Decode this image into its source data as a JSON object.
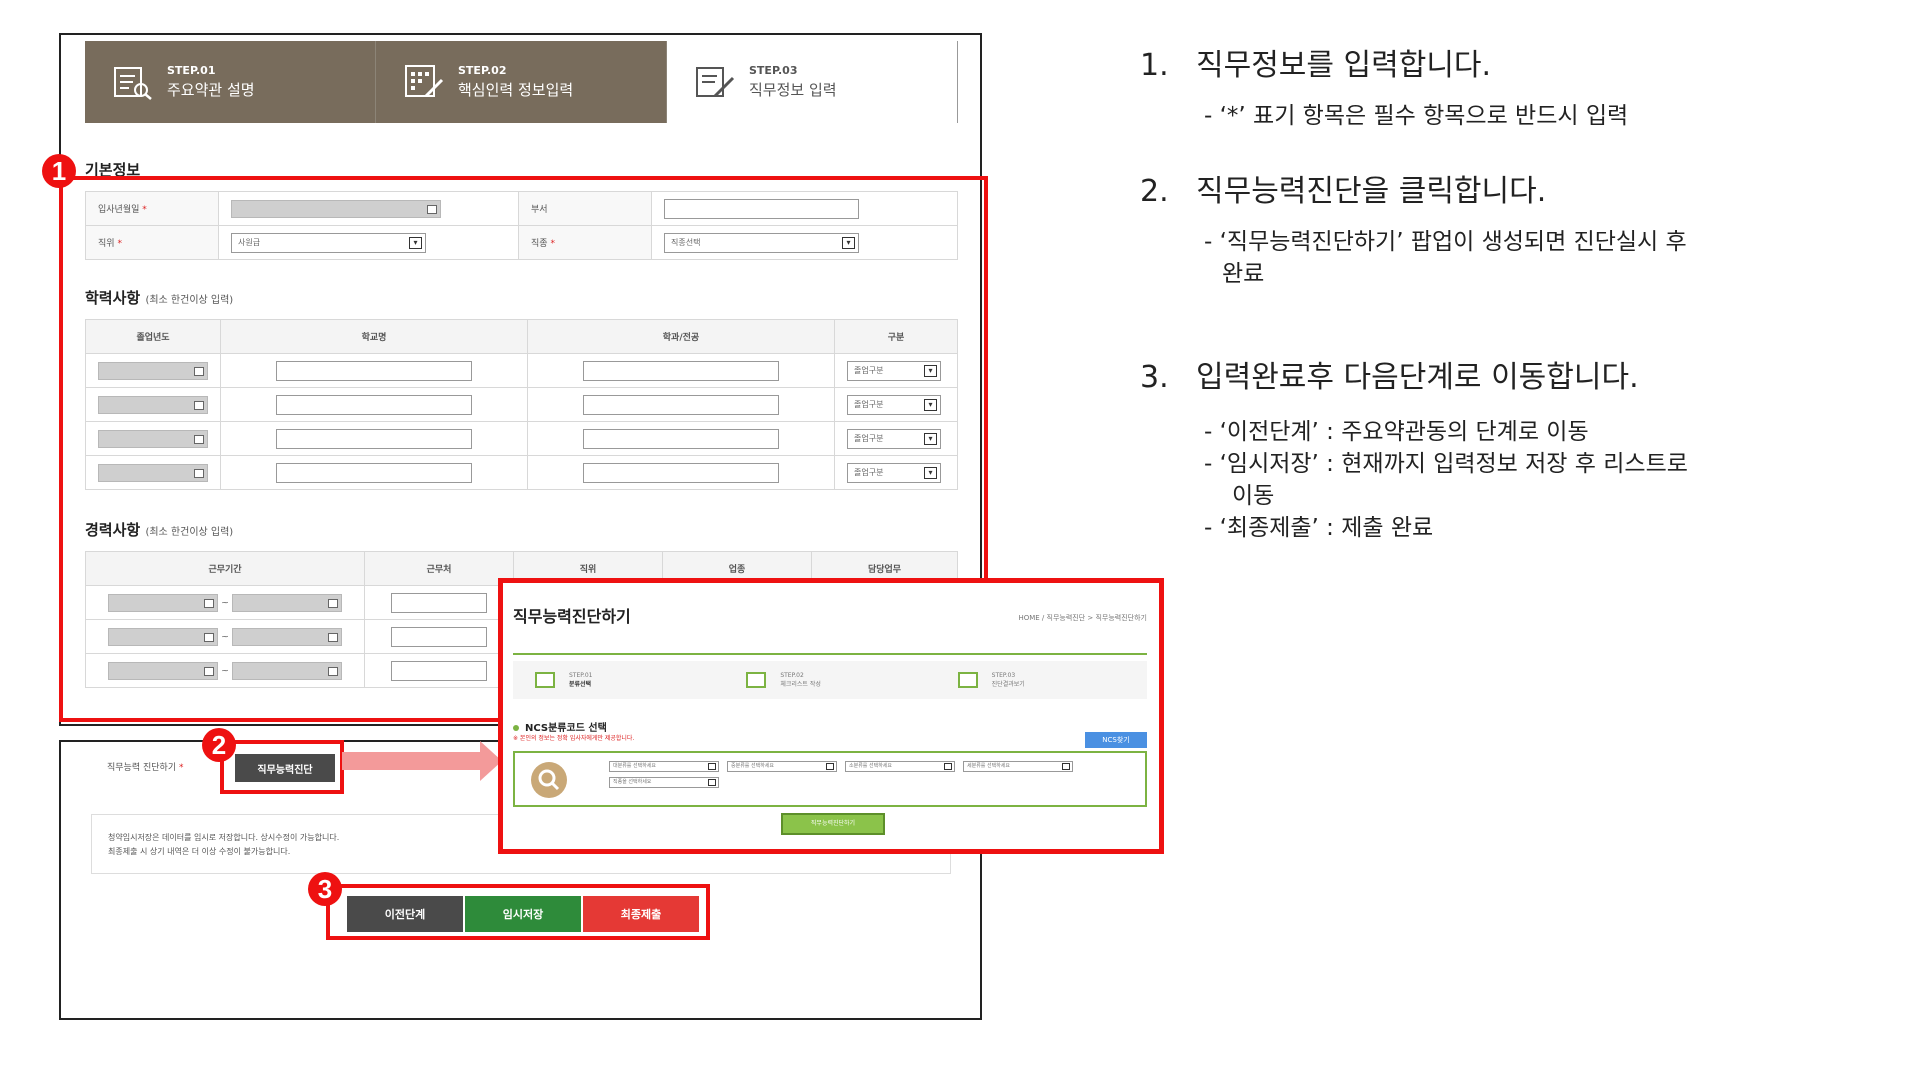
{
  "steps": [
    {
      "num": "STEP.01",
      "title": "주요약관 설명",
      "icon": "document-search-icon"
    },
    {
      "num": "STEP.02",
      "title": "핵심인력 정보입력",
      "icon": "keypad-edit-icon"
    },
    {
      "num": "STEP.03",
      "title": "직무정보 입력",
      "icon": "document-edit-icon"
    }
  ],
  "basic": {
    "title": "기본정보",
    "hire_date_label": "입사년월일",
    "dept_label": "부서",
    "position_label": "직위",
    "position_value": "사원급",
    "jobtype_label": "직종",
    "jobtype_value": "직종선택",
    "required_mark": "*"
  },
  "education": {
    "title": "학력사항",
    "note": "(최소 한건이상 입력)",
    "columns": [
      "졸업년도",
      "학교명",
      "학과/전공",
      "구분"
    ],
    "division_value": "졸업구분"
  },
  "career": {
    "title": "경력사항",
    "note": "(최소 한건이상 입력)",
    "columns": [
      "근무기간",
      "근무처",
      "직위",
      "업종",
      "담당업무"
    ],
    "dash": "~"
  },
  "diagnosis": {
    "label": "직무능력 진단하기",
    "button": "직무능력진단"
  },
  "notice": {
    "line1": "청약임시저장은 데이터를 임시로 저장합니다. 상시수정이 가능합니다.",
    "line2": "최종제출 시 상기 내역은 더 이상 수정이 불가능합니다."
  },
  "buttons": {
    "prev": "이전단계",
    "save": "임시저장",
    "submit": "최종제출"
  },
  "markers": [
    "1",
    "2",
    "3"
  ],
  "popup": {
    "title": "직무능력진단하기",
    "crumb": "HOME / 직무능력진단 > 직무능력진단하기",
    "steps": [
      {
        "num": "STEP.01",
        "title": "분류선택"
      },
      {
        "num": "STEP.02",
        "title": "체크리스트 작성"
      },
      {
        "num": "STEP.03",
        "title": "진단결과보기"
      }
    ],
    "section": "NCS분류코드 선택",
    "sub": "※ 본인의 정보는 정확 입사자에게만 제공합니다.",
    "ncs": "NCS찾기",
    "selects": [
      "대분류를 선택하세요",
      "중분류를 선택하세요",
      "소분류를 선택하세요",
      "세분류를 선택하세요",
      "직종을 선택하세요"
    ],
    "run": "직무능력진단하기"
  },
  "instructions": [
    {
      "no": "1.",
      "title": "직무정보를 입력합니다.",
      "details": [
        "- ‘*’ 표기 항목은 필수 항목으로 반드시 입력"
      ]
    },
    {
      "no": "2.",
      "title": "직무능력진단을 클릭합니다.",
      "details": [
        "- ‘직무능력진단하기’ 팝업이 생성되면 진단실시 후",
        "   완료"
      ]
    },
    {
      "no": "3.",
      "title": "입력완료후 다음단계로 이동합니다.",
      "details": [
        "- ‘이전단계’ : 주요약관동의 단계로 이동",
        "- ‘임시저장’ : 현재까지 입력정보 저장 후 리스트로",
        "   이동",
        "- ‘최종제출’ : 제출 완료"
      ]
    }
  ],
  "colors": {
    "accent_red": "#e11111",
    "step_brown": "#786c5c",
    "green": "#7cb342",
    "btn_gray": "#4a4a4a",
    "btn_green": "#2e8b3a",
    "btn_red": "#e53935"
  }
}
